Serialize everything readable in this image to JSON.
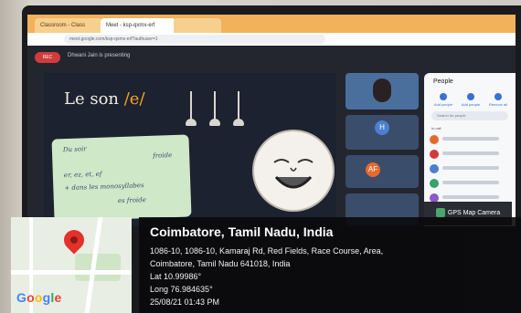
{
  "browser": {
    "tabs": [
      "Classroom - Class",
      "Meet - ksp-qxmx-erf",
      ""
    ],
    "address": "meet.google.com/ksp-qxmx-erf?authuser=1"
  },
  "meet": {
    "present_pill": "REC",
    "presenting_text": "Dhwani Jain is presenting",
    "participant_initials": [
      "H",
      "AF"
    ],
    "people_panel": {
      "title": "People",
      "buttons": [
        "Add people",
        "Add people",
        "Remove all"
      ],
      "search_placeholder": "Search for people",
      "section": "In call"
    }
  },
  "slide": {
    "title_word": "Le son",
    "title_sound": "/e/",
    "note_lines": [
      "Du soir",
      "froide",
      "er, ez, et, ef",
      "+ dans les monosyllabes",
      "es froide"
    ]
  },
  "gps": {
    "badge": "GPS Map Camera",
    "city": "Coimbatore, Tamil Nadu, India",
    "address_line1": "1086-10, 1086-10, Kamaraj Rd, Red Fields, Race Course, Area,",
    "address_line2": "Coimbatore, Tamil Nadu 641018, India",
    "lat": "Lat 10.99986°",
    "long": "Long 76.984635°",
    "datetime": "25/08/21 01:43 PM",
    "google_logo": "Google",
    "colors": {
      "pin": "#e3322b",
      "g_blue": "#4285f4",
      "g_red": "#ea4335",
      "g_yellow": "#fbbc05",
      "g_green": "#34a853"
    }
  }
}
